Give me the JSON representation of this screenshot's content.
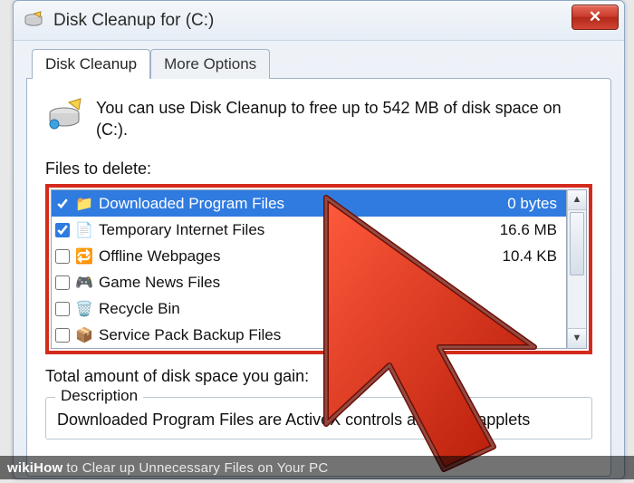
{
  "window": {
    "title": "Disk Cleanup for  (C:)",
    "close_glyph": "✕"
  },
  "tabs": {
    "active": "Disk Cleanup",
    "other": "More Options"
  },
  "intro": "You can use Disk Cleanup to free up to 542 MB of disk space on  (C:).",
  "files_label": "Files to delete:",
  "rows": [
    {
      "checked": true,
      "icon": "📁",
      "name": "Downloaded Program Files",
      "size": "0 bytes",
      "selected": true
    },
    {
      "checked": true,
      "icon": "📄",
      "name": "Temporary Internet Files",
      "size": "16.6 MB",
      "selected": false
    },
    {
      "checked": false,
      "icon": "🔁",
      "name": "Offline Webpages",
      "size": "10.4 KB",
      "selected": false
    },
    {
      "checked": false,
      "icon": "🎮",
      "name": "Game News Files",
      "size": "",
      "selected": false
    },
    {
      "checked": false,
      "icon": "🗑️",
      "name": "Recycle Bin",
      "size": "",
      "selected": false
    },
    {
      "checked": false,
      "icon": "📦",
      "name": "Service Pack Backup Files",
      "size": "",
      "selected": false
    }
  ],
  "total_label": "Total amount of disk space you gain:",
  "description": {
    "legend": "Description",
    "text": "Downloaded Program Files are ActiveX controls and Java applets"
  },
  "watermark": {
    "brand": "wikiHow",
    "text": " to Clear up Unnecessary Files on Your PC"
  },
  "colors": {
    "highlight_border": "#d42a1c",
    "selection_bg": "#2f7be0"
  }
}
